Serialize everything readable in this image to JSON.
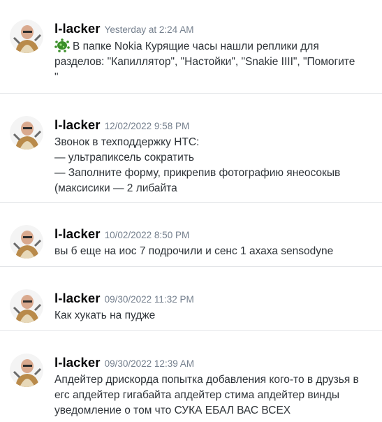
{
  "messages": [
    {
      "author": "l-lacker",
      "timestamp": "Yesterday at 2:24 AM",
      "emoji": "germ-emoji",
      "lines": [
        "В папке Nokia Курящие часы нашли реплики для",
        "разделов: \"Капиллятор\", \"Настойки\", \"Snakie IIII\", \"Помогите",
        "\""
      ]
    },
    {
      "author": "l-lacker",
      "timestamp": "12/02/2022 9:58 PM",
      "lines": [
        "Звонок в техподдержку HTC:",
        "— ультрапиксель сократить",
        "— Заполните форму, прикрепив фотографию янеосокыв",
        "(максисики — 2 либайта"
      ]
    },
    {
      "author": "l-lacker",
      "timestamp": "10/02/2022 8:50 PM",
      "lines": [
        "вы б еще на иос 7 подрочили и сенс 1 ахаха sensodyne"
      ]
    },
    {
      "author": "l-lacker",
      "timestamp": "09/30/2022 11:32 PM",
      "lines": [
        "Как хукать на пудже"
      ]
    },
    {
      "author": "l-lacker",
      "timestamp": "09/30/2022 12:39 AM",
      "lines": [
        "Апдейтер дрискорда попытка добавления кого-то в друзья в",
        "егс апдейтер гигабайта апдейтер стима апдейтер винды",
        "уведомление о том что СУКА ЕБАЛ ВАС ВСЕХ"
      ]
    }
  ],
  "colors": {
    "username": "#060607",
    "timestamp": "#747f8d",
    "text": "#2e3338",
    "divider": "#e3e5e8",
    "background": "#ffffff"
  }
}
